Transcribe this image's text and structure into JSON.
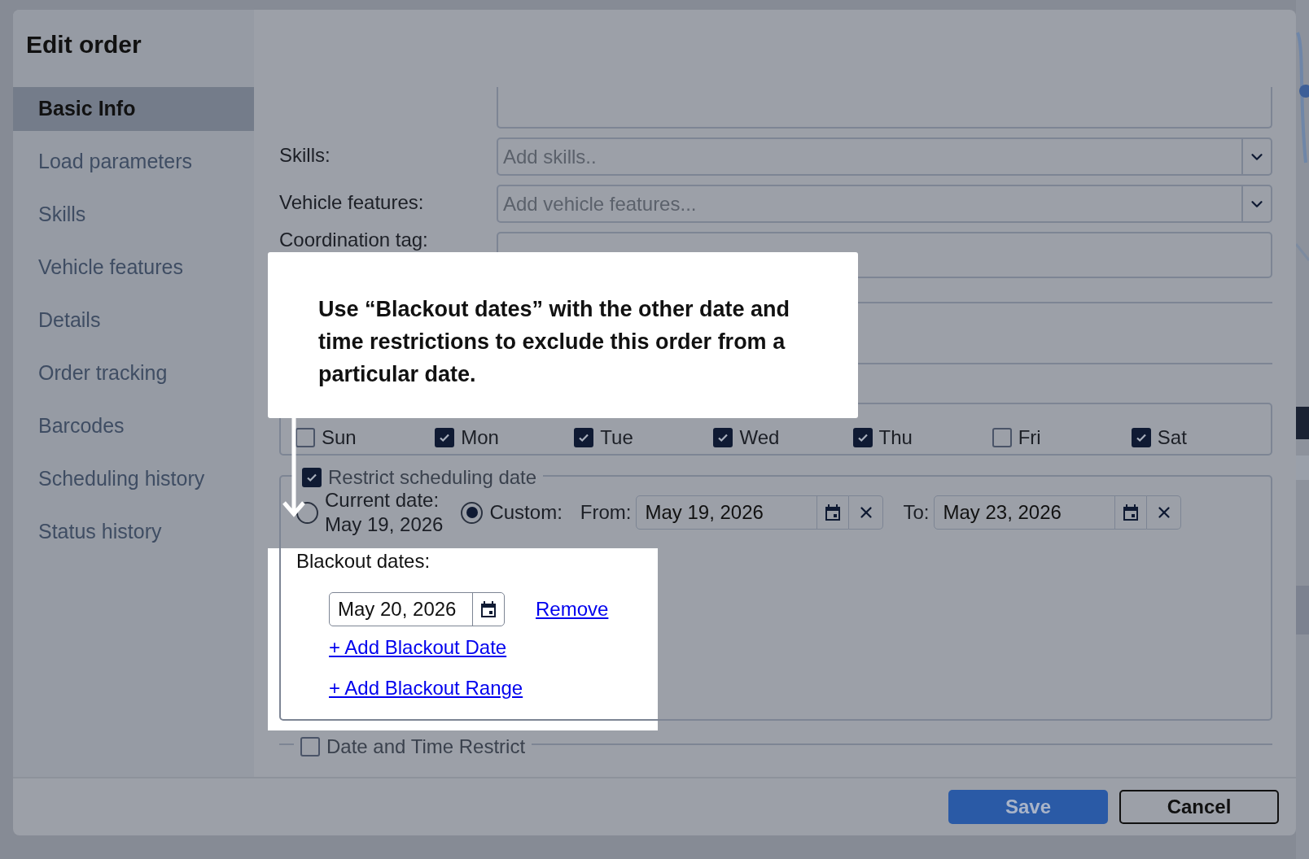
{
  "dialog": {
    "title": "Edit order"
  },
  "sidebar": {
    "items": [
      {
        "label": "Basic Info",
        "selected": true
      },
      {
        "label": "Load parameters",
        "selected": false
      },
      {
        "label": "Skills",
        "selected": false
      },
      {
        "label": "Vehicle features",
        "selected": false
      },
      {
        "label": "Details",
        "selected": false
      },
      {
        "label": "Order tracking",
        "selected": false
      },
      {
        "label": "Barcodes",
        "selected": false
      },
      {
        "label": "Scheduling history",
        "selected": false
      },
      {
        "label": "Status history",
        "selected": false
      }
    ]
  },
  "form": {
    "fields": [
      {
        "kind": "textarea"
      },
      {
        "kind": "select",
        "label": "Skills:",
        "placeholder": "Add skills.."
      },
      {
        "kind": "select",
        "label": "Vehicle features:",
        "placeholder": "Add vehicle features..."
      },
      {
        "kind": "text",
        "label": "Coordination tag:"
      }
    ],
    "weekdays": [
      {
        "label": "Sun",
        "checked": false
      },
      {
        "label": "Mon",
        "checked": true
      },
      {
        "label": "Tue",
        "checked": true
      },
      {
        "label": "Wed",
        "checked": true
      },
      {
        "label": "Thu",
        "checked": true
      },
      {
        "label": "Fri",
        "checked": false
      },
      {
        "label": "Sat",
        "checked": true
      }
    ]
  },
  "restrict": {
    "legend": "Restrict scheduling date",
    "checked": true,
    "options": [
      {
        "kind": "current",
        "label": "Current date:",
        "value": "May 19, 2026",
        "selected": false
      },
      {
        "kind": "custom",
        "label": "Custom:",
        "selected": true
      }
    ],
    "from": {
      "label": "From:",
      "value": "May 19, 2026"
    },
    "to": {
      "label": "To:",
      "value": "May 23, 2026"
    },
    "blackout": {
      "label": "Blackout dates:",
      "dates": [
        {
          "value": "May 20, 2026",
          "action": "Remove"
        }
      ],
      "links": [
        "+ Add Blackout Date",
        "+ Add Blackout Range"
      ]
    }
  },
  "date_time": {
    "legend": "Date and Time Restrict",
    "checked": false
  },
  "callout": {
    "text": "Use “Blackout dates” with the other date and time restrictions to exclude this order from a particular date."
  },
  "buttons": [
    {
      "label": "Save",
      "kind": "primary"
    },
    {
      "label": "Cancel",
      "kind": "secondary"
    }
  ]
}
